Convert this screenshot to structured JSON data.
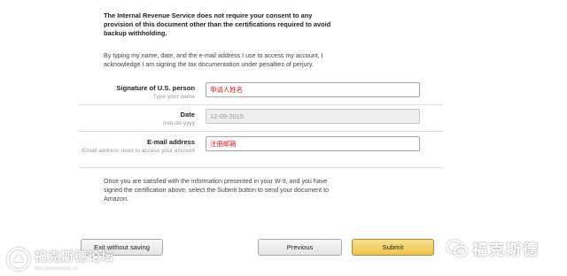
{
  "consent_notice": "The Internal Revenue Service does not require your consent to any provision of this document other than the certifications required to avoid backup withholding.",
  "typing_notice": "By typing my name, date, and the e-mail address I use to access my account, I acknowledge I am signing the tax documentation under penalties of perjury.",
  "form": {
    "signature": {
      "label": "Signature of U.S. person",
      "hint": "Type your name",
      "value": "申请人姓名"
    },
    "date": {
      "label": "Date",
      "hint": "mm-dd-yyyy",
      "value": "12-09-2015"
    },
    "email": {
      "label": "E-mail address",
      "hint": "Email address used to access your account",
      "value": "注册邮箱"
    }
  },
  "satisfied_notice": "Once you are satisfied with the information presented in your W-9, and you have signed the certification above, select the Submit button to send your document to Amazon.",
  "buttons": {
    "exit": "Exit without saving",
    "previous": "Previous",
    "submit": "Submit"
  },
  "watermarks": {
    "left_title": "福克斯德论坛",
    "left_subtitle": "bbs.asiacomtec.cn",
    "right_title": "福克斯德"
  },
  "colors": {
    "submit_button": "#efc44d",
    "entered_text": "#e0201e",
    "disabled_field": "#eeeeee"
  }
}
